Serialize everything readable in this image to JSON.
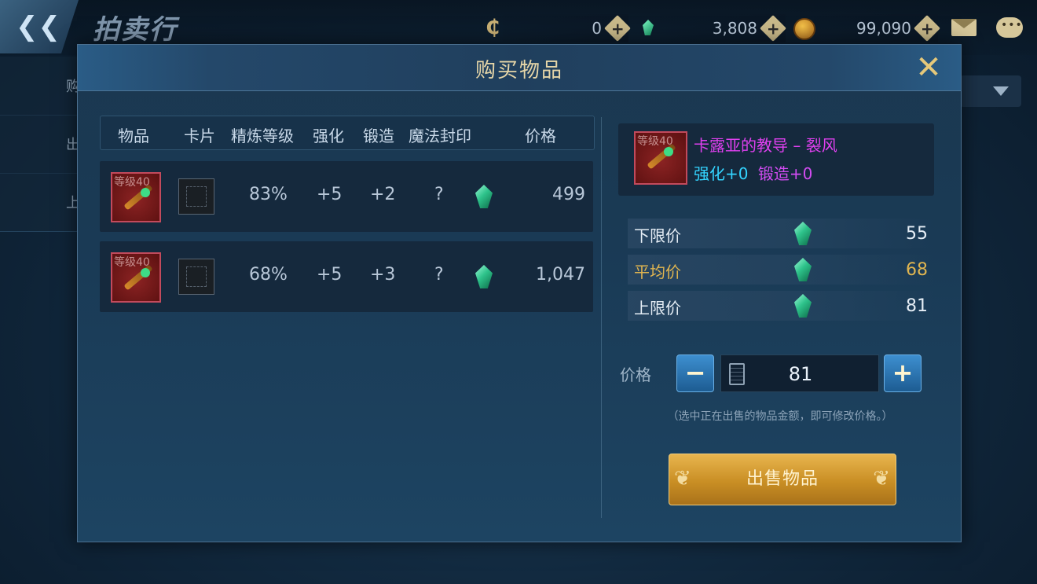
{
  "header": {
    "page_title": "拍卖行",
    "back_icon": "back-arrow-icon",
    "currencies": [
      {
        "icon": "c-currency-icon",
        "value": "0"
      },
      {
        "icon": "green-gem-icon",
        "value": "3,808"
      },
      {
        "icon": "gold-coin-icon",
        "value": "99,090"
      }
    ]
  },
  "background_tabs": [
    "购",
    "出",
    "上"
  ],
  "dialog": {
    "title": "购买物品",
    "table": {
      "columns": [
        "物品",
        "卡片",
        "精炼等级",
        "强化",
        "锻造",
        "魔法封印",
        "价格"
      ],
      "rows": [
        {
          "icon_level": "等级40",
          "refine": "83%",
          "enhance": "+5",
          "forge": "+2",
          "seal": "?",
          "price": "499"
        },
        {
          "icon_level": "等级40",
          "refine": "68%",
          "enhance": "+5",
          "forge": "+3",
          "seal": "?",
          "price": "1,047"
        }
      ]
    },
    "selected_item": {
      "icon_level": "等级40",
      "name": "卡露亚的教导 – 裂风",
      "enhance": "强化+0",
      "forge": "锻造+0"
    },
    "price_stats": [
      {
        "label": "下限价",
        "value": "55"
      },
      {
        "label": "平均价",
        "value": "68"
      },
      {
        "label": "上限价",
        "value": "81"
      }
    ],
    "price_label": "价格",
    "price_value": "81",
    "minus_label": "−",
    "plus_label": "+",
    "hint": "（选中正在出售的物品金额，即可修改价格。）",
    "sell_button": "出售物品",
    "colors": {
      "accent_gold": "#e0b550",
      "item_name": "#e040f0",
      "enhance": "#33d4ff",
      "forge": "#d24cf2"
    }
  }
}
